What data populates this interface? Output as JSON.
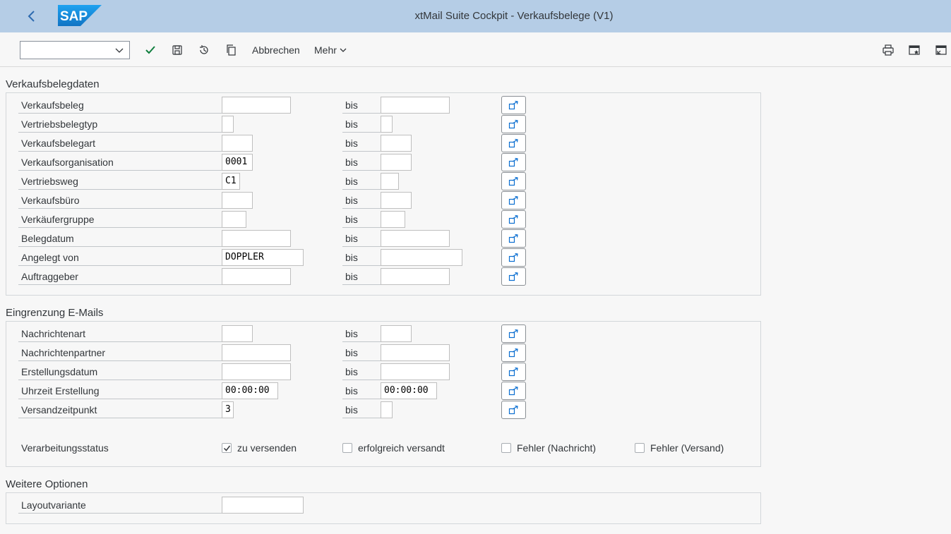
{
  "window": {
    "title": "xtMail Suite Cockpit - Verkaufsbelege (V1)",
    "logo_text": "SAP"
  },
  "toolbar": {
    "command_value": "",
    "cancel_label": "Abbrechen",
    "more_label": "Mehr"
  },
  "sections": {
    "sales": {
      "title": "Verkaufsbelegdaten",
      "rows": [
        {
          "label": "Verkaufsbeleg",
          "from": "",
          "to": ""
        },
        {
          "label": "Vertriebsbelegtyp",
          "from": "",
          "to": ""
        },
        {
          "label": "Verkaufsbelegart",
          "from": "",
          "to": ""
        },
        {
          "label": "Verkaufsorganisation",
          "from": "0001",
          "to": ""
        },
        {
          "label": "Vertriebsweg",
          "from": "C1",
          "to": ""
        },
        {
          "label": "Verkaufsbüro",
          "from": "",
          "to": ""
        },
        {
          "label": "Verkäufergruppe",
          "from": "",
          "to": ""
        },
        {
          "label": "Belegdatum",
          "from": "",
          "to": ""
        },
        {
          "label": "Angelegt von",
          "from": "DOPPLER",
          "to": ""
        },
        {
          "label": "Auftraggeber",
          "from": "",
          "to": ""
        }
      ]
    },
    "emails": {
      "title": "Eingrenzung E-Mails",
      "rows": [
        {
          "label": "Nachrichtenart",
          "from": "",
          "to": ""
        },
        {
          "label": "Nachrichtenpartner",
          "from": "",
          "to": ""
        },
        {
          "label": "Erstellungsdatum",
          "from": "",
          "to": ""
        },
        {
          "label": "Uhrzeit Erstellung",
          "from": "00:00:00",
          "to": "00:00:00"
        },
        {
          "label": "Versandzeitpunkt",
          "from": "3",
          "to": ""
        }
      ],
      "status": {
        "label": "Verarbeitungsstatus",
        "options": [
          {
            "label": "zu versenden",
            "checked": true
          },
          {
            "label": "erfolgreich versandt",
            "checked": false
          },
          {
            "label": "Fehler (Nachricht)",
            "checked": false
          },
          {
            "label": "Fehler (Versand)",
            "checked": false
          }
        ]
      }
    },
    "options": {
      "title": "Weitere Optionen",
      "layout_label": "Layoutvariante",
      "layout_value": ""
    }
  },
  "range_label": "bis",
  "colors": {
    "shell": "#b5cde6",
    "accent_check": "#107e3e",
    "icon": "#0a6ed1",
    "sap_blue": "#1a8fe3"
  }
}
